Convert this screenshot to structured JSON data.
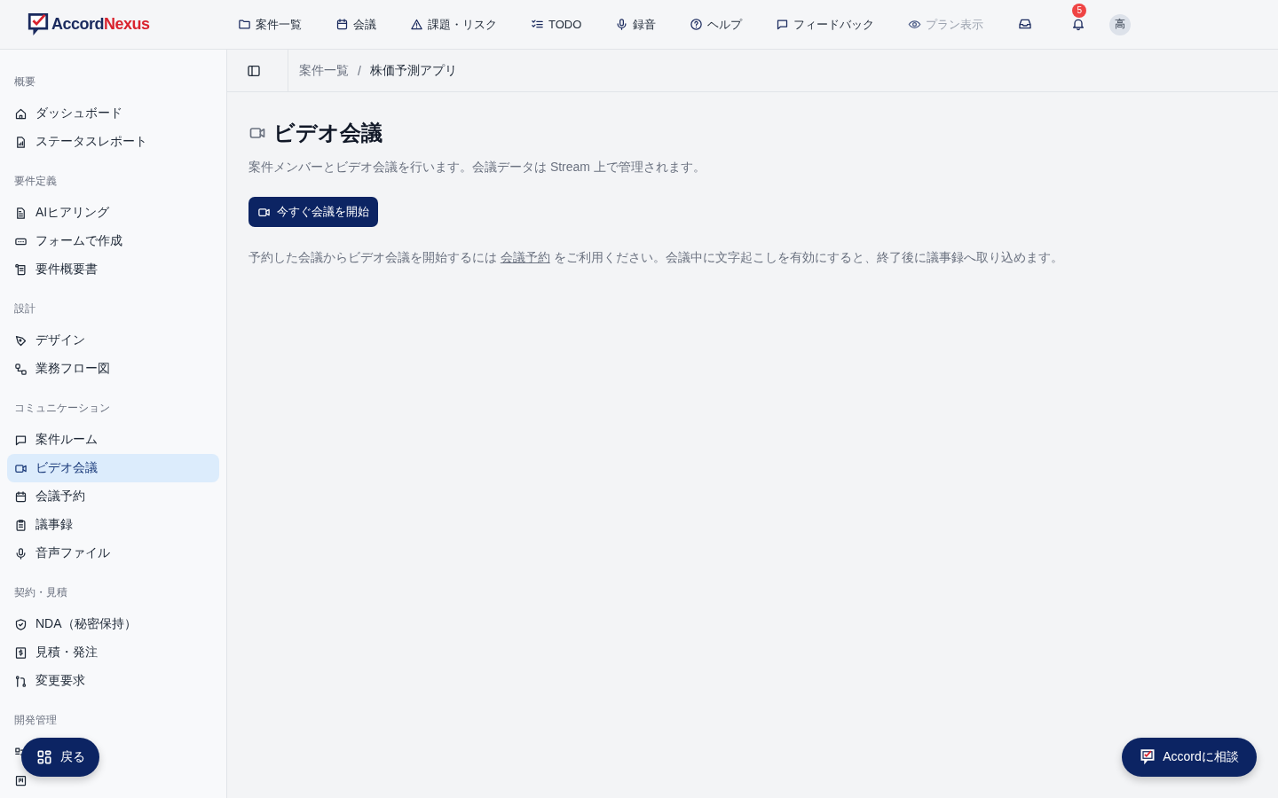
{
  "logo": {
    "part1": "Accord",
    "part2": "Nexus"
  },
  "nav": [
    {
      "label": "案件一覧",
      "disabled": false
    },
    {
      "label": "会議",
      "disabled": false
    },
    {
      "label": "課題・リスク",
      "disabled": false
    },
    {
      "label": "TODO",
      "disabled": false
    },
    {
      "label": "録音",
      "disabled": false
    },
    {
      "label": "ヘルプ",
      "disabled": false
    },
    {
      "label": "フィードバック",
      "disabled": false
    },
    {
      "label": "プラン表示",
      "disabled": true
    }
  ],
  "notifications": {
    "count": "5"
  },
  "avatar": {
    "initial": "高"
  },
  "sidebar": {
    "sections": [
      {
        "title": "概要",
        "items": [
          {
            "label": "ダッシュボード",
            "selected": false
          },
          {
            "label": "ステータスレポート",
            "selected": false
          }
        ]
      },
      {
        "title": "要件定義",
        "items": [
          {
            "label": "AIヒアリング",
            "selected": false
          },
          {
            "label": "フォームで作成",
            "selected": false
          },
          {
            "label": "要件概要書",
            "selected": false
          }
        ]
      },
      {
        "title": "設計",
        "items": [
          {
            "label": "デザイン",
            "selected": false
          },
          {
            "label": "業務フロー図",
            "selected": false
          }
        ]
      },
      {
        "title": "コミュニケーション",
        "items": [
          {
            "label": "案件ルーム",
            "selected": false
          },
          {
            "label": "ビデオ会議",
            "selected": true
          },
          {
            "label": "会議予約",
            "selected": false
          },
          {
            "label": "議事録",
            "selected": false
          },
          {
            "label": "音声ファイル",
            "selected": false
          }
        ]
      },
      {
        "title": "契約・見積",
        "items": [
          {
            "label": "NDA（秘密保持）",
            "selected": false
          },
          {
            "label": "見積・発注",
            "selected": false
          },
          {
            "label": "変更要求",
            "selected": false
          }
        ]
      },
      {
        "title": "開発管理",
        "items": [
          {
            "selected": false
          },
          {
            "selected": false
          }
        ]
      }
    ]
  },
  "breadcrumb": {
    "items": [
      {
        "label": "案件一覧"
      },
      {
        "label": "株価予測アプリ"
      }
    ],
    "separator": "/"
  },
  "page": {
    "title": "ビデオ会議",
    "description": "案件メンバーとビデオ会議を行います。会議データは Stream 上で管理されます。",
    "start_button": "今すぐ会議を開始",
    "note_before": "予約した会議からビデオ会議を開始するには",
    "note_link": "会議予約",
    "note_after": "をご利用ください。会議中に文字起こしを有効にすると、終了後に議事録へ取り込めます。"
  },
  "back_button": "戻る",
  "consult_button": "Accordに相談"
}
